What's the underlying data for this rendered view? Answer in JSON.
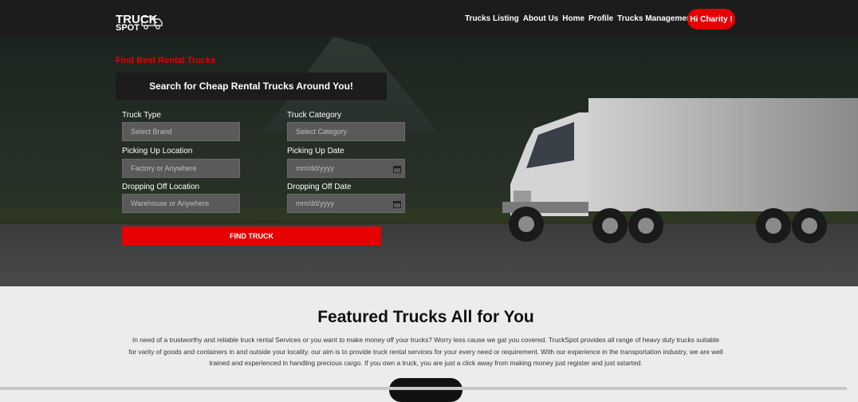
{
  "nav": {
    "logo_line1": "TRUCK",
    "logo_line2": "SPOT",
    "items": [
      "Trucks Listing",
      "About Us",
      "Home",
      "Profile",
      "Trucks Management"
    ],
    "user_button": "Hi Charity !"
  },
  "hero": {
    "tagline": "Find Best Rental Trucks",
    "search_heading": "Search for Cheap Rental Trucks Around You!",
    "fields": {
      "truck_type_label": "Truck Type",
      "truck_type_placeholder": "Select Brand",
      "truck_category_label": "Truck Category",
      "truck_category_placeholder": "Select Category",
      "pickup_location_label": "Picking Up Location",
      "pickup_location_placeholder": "Factory or Anywhere",
      "pickup_date_label": "Picking Up Date",
      "pickup_date_placeholder": "mm/dd/yyyy",
      "dropoff_location_label": "Dropping Off Location",
      "dropoff_location_placeholder": "Warehouse or Anywhere",
      "dropoff_date_label": "Dropping Off Date",
      "dropoff_date_placeholder": "mm/dd/yyyy"
    },
    "find_button": "FIND TRUCK"
  },
  "featured": {
    "title": "Featured Trucks All for You",
    "description": "In need of a trustworthy and reliable truck rental Services or you want to make money off your trucks? Worry less cause we gat you covered. TruckSpot provides all range of heavy duty trucks suitable for varity of goods and containers in and outside your locality. our aim is to provide truck rental services for your every need or requirement. With our experience in the transportation industry, we are well trained and experienced in handling precious cargo. If you own a truck, you are just a click away from making money just register and just sstarted."
  },
  "colors": {
    "accent": "#e60000",
    "nav_bg": "#1c1c1c",
    "page_bg": "#ececec"
  }
}
